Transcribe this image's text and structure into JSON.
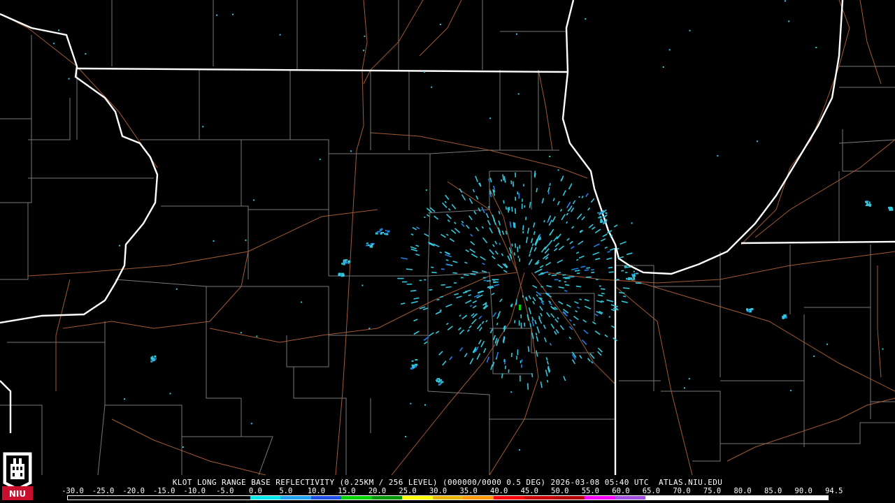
{
  "caption": "KLOT LONG RANGE BASE REFLECTIVITY (0.25KM / 256 LEVEL) (000000/0000 0.5 DEG) 2026-03-08 05:40 UTC  ATLAS.NIU.EDU",
  "scale": {
    "labels": [
      "-30.0",
      "-25.0",
      "-20.0",
      "-15.0",
      "-10.0",
      "-5.0",
      "0.0",
      "5.0",
      "10.0",
      "15.0",
      "20.0",
      "25.0",
      "30.0",
      "35.0",
      "40.0",
      "45.0",
      "50.0",
      "55.0",
      "60.0",
      "65.0",
      "70.0",
      "75.0",
      "80.0",
      "85.0",
      "90.0",
      "94.5"
    ],
    "colors": [
      "#000000",
      "#000000",
      "#000000",
      "#000000",
      "#000000",
      "#000000",
      "#00e6e6",
      "#20a0f0",
      "#1e50e6",
      "#00d200",
      "#009600",
      "#ffff00",
      "#e6b400",
      "#ff9600",
      "#ff0000",
      "#c80000",
      "#b40000",
      "#ff00ff",
      "#a050dc",
      "#ffffff",
      "#ffffff",
      "#ffffff",
      "#ffffff",
      "#ffffff",
      "#ffffff"
    ]
  },
  "logo": {
    "text": "NIU",
    "color": "#c8102e"
  },
  "colors": {
    "state_border": "#ffffff",
    "county_border": "#8c8c8c",
    "road": "#b4643c",
    "echo_light": "#34c8dc",
    "echo_medium": "#2080e8"
  }
}
